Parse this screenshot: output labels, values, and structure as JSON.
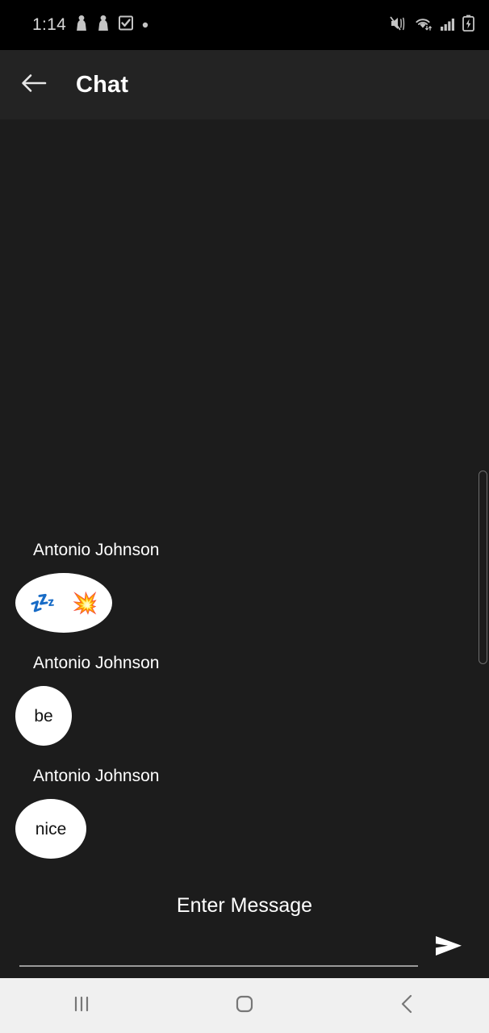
{
  "status_bar": {
    "time": "1:14",
    "left_icons": [
      "notification-pawn-icon",
      "notification-pawn-icon",
      "checkbox-icon",
      "dot-icon"
    ],
    "right_icons": [
      "mute-vibrate-icon",
      "wifi-icon",
      "signal-bars-icon",
      "battery-charging-icon"
    ],
    "background": "#000000",
    "icon_color": "#c4c4c4"
  },
  "header": {
    "title": "Chat",
    "back_icon": "arrow-left-icon",
    "background": "#232323"
  },
  "chat": {
    "background": "#1c1c1c",
    "bubble_color": "#ffffff",
    "bubble_text_color": "#121212",
    "messages": [
      {
        "sender": "Antonio Johnson",
        "text": "",
        "emojis": [
          "💤",
          "💥"
        ],
        "type": "emoji"
      },
      {
        "sender": "Antonio Johnson",
        "text": "be",
        "emojis": [],
        "type": "text"
      },
      {
        "sender": "Antonio Johnson",
        "text": "nice",
        "emojis": [],
        "type": "text"
      }
    ]
  },
  "input": {
    "label": "Enter Message",
    "value": "",
    "placeholder": "",
    "send_icon": "send-paper-plane-icon"
  },
  "navbar": {
    "background": "#f0f0f0",
    "icon_color": "#777777",
    "buttons": [
      {
        "name": "recents",
        "icon": "recents-icon"
      },
      {
        "name": "home",
        "icon": "home-icon"
      },
      {
        "name": "back",
        "icon": "chevron-left-icon"
      }
    ]
  }
}
